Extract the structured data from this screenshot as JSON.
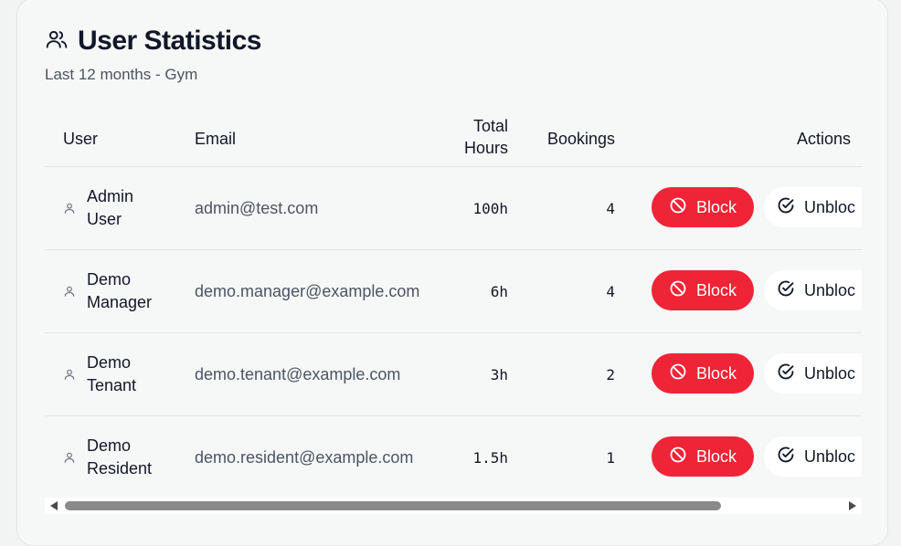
{
  "header": {
    "title": "User Statistics",
    "subtitle": "Last 12 months - Gym",
    "icon": "users-icon"
  },
  "columns": {
    "user": "User",
    "email": "Email",
    "total_hours": "Total\nHours",
    "bookings": "Bookings",
    "actions": "Actions"
  },
  "rows": [
    {
      "name": "Admin User",
      "email": "admin@test.com",
      "hours": "100h",
      "bookings": "4"
    },
    {
      "name": "Demo Manager",
      "email": "demo.manager@example.com",
      "hours": "6h",
      "bookings": "4"
    },
    {
      "name": "Demo Tenant",
      "email": "demo.tenant@example.com",
      "hours": "3h",
      "bookings": "2"
    },
    {
      "name": "Demo Resident",
      "email": "demo.resident@example.com",
      "hours": "1.5h",
      "bookings": "1"
    }
  ],
  "actions": {
    "block_label": "Block",
    "unblock_label": "Unbloc"
  },
  "colors": {
    "block_button": "#ef2436",
    "unblock_button": "#ffffff",
    "card_background": "#f6f7f7"
  }
}
